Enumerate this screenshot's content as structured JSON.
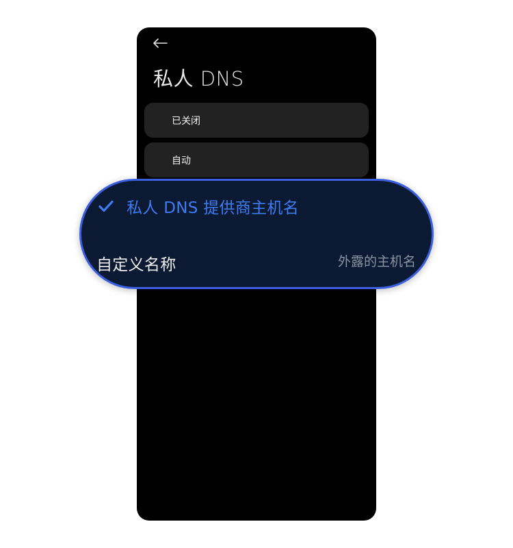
{
  "header": {
    "title": "私人 DNS"
  },
  "options": [
    {
      "label": "已关闭"
    },
    {
      "label": "自动"
    }
  ],
  "selected_option": {
    "label": "私人 DNS 提供商主机名",
    "checked": true
  },
  "custom_name": {
    "label": "自定义名称",
    "placeholder": "外露的主机名"
  },
  "icons": {
    "back": "back-arrow-icon",
    "check": "checkmark-icon"
  },
  "colors": {
    "accent": "#3d7cf2",
    "highlight_border": "#3a5fe0",
    "card_background": "#0b1a32",
    "screen_background": "#000000",
    "option_background": "#222222"
  }
}
